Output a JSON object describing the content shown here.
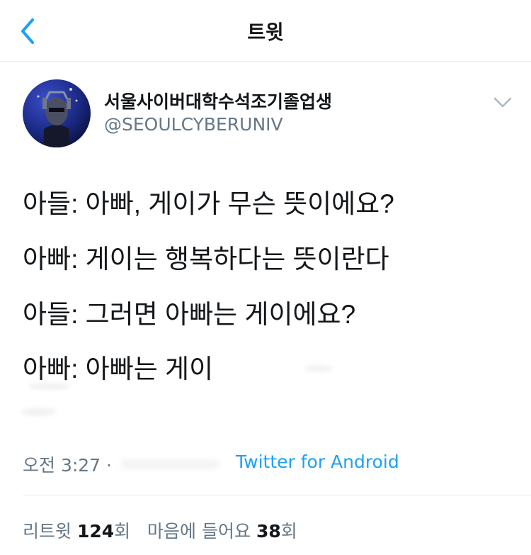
{
  "header": {
    "title": "트윗",
    "back_icon": "chevron-left-icon",
    "accent_color": "#1da1f2"
  },
  "tweet": {
    "author": {
      "display_name": "서울사이버대학수석조기졸업생",
      "handle": "@SEOULCYBERUNIV"
    },
    "lines": [
      "아들: 아빠, 게이가 무슨 뜻이에요?",
      "아빠: 게이는 행복하다는 뜻이란다",
      "아들: 그러면 아빠는 게이에요?",
      "아빠: 아빠는 게이"
    ],
    "time": "오전 3:27 ·",
    "source": "Twitter for Android"
  },
  "stats": {
    "retweet_label": "리트윗",
    "retweet_count": "124",
    "retweet_unit": "회",
    "like_label": "마음에 들어요",
    "like_count": "38",
    "like_unit": "회"
  }
}
